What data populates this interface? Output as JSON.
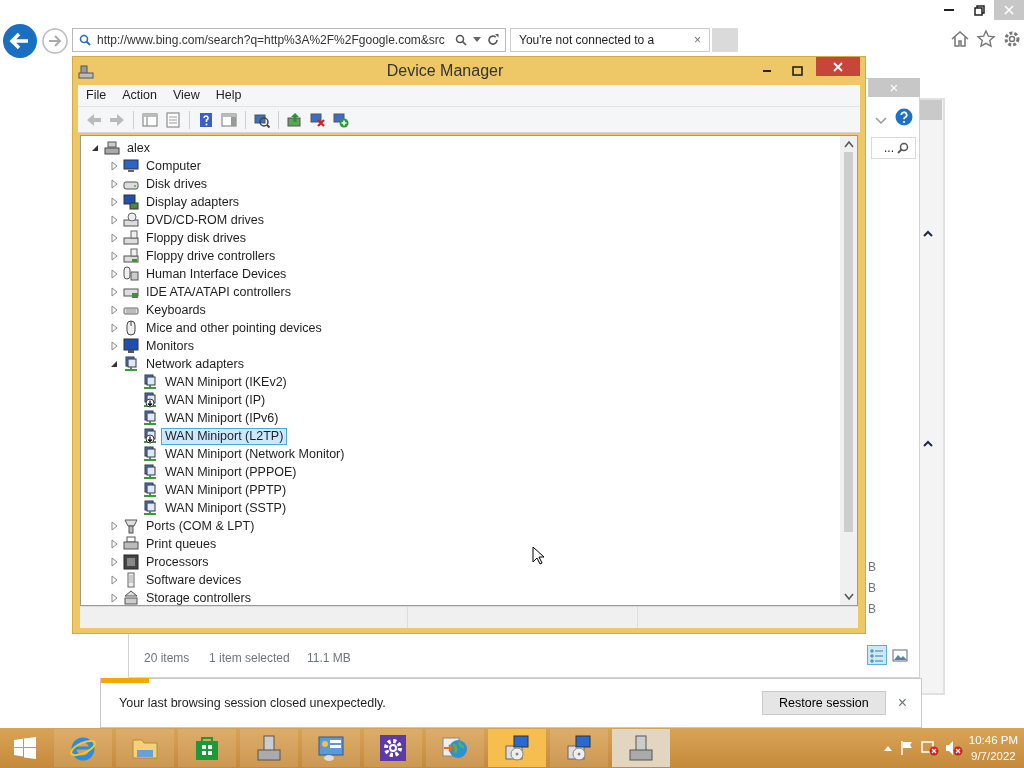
{
  "browser": {
    "address": "http://www.bing.com/search?q=http%3A%2F%2Fgoogle.com&src",
    "tab": {
      "title": "You're not connected to a",
      "close": "×"
    }
  },
  "explorer_dialog": {
    "close": "×",
    "search_text": "...",
    "size_fragments": [
      "B",
      "B",
      "B"
    ],
    "status": {
      "items": "20 items",
      "selection": "1 item selected",
      "size": "11.1 MB"
    },
    "views": [
      {
        "kind": "details",
        "selected": true
      },
      {
        "kind": "preview",
        "selected": false
      }
    ]
  },
  "device_manager": {
    "title": "Device Manager",
    "menu": [
      "File",
      "Action",
      "View",
      "Help"
    ],
    "toolbar": [
      {
        "kind": "back",
        "disabled": true
      },
      {
        "kind": "forward",
        "disabled": true
      },
      {
        "kind": "tree",
        "disabled": false
      },
      {
        "kind": "list",
        "disabled": false
      },
      {
        "kind": "help",
        "disabled": false
      },
      {
        "kind": "panel",
        "disabled": false
      },
      {
        "kind": "scan",
        "disabled": false
      },
      {
        "kind": "update",
        "disabled": false
      },
      {
        "kind": "remove",
        "disabled": false
      },
      {
        "kind": "add",
        "disabled": false
      }
    ],
    "tree": [
      {
        "label": "alex",
        "kind": "root",
        "expanded": true,
        "selected": false,
        "children": [
          {
            "label": "Computer",
            "kind": "computer",
            "expanded": false,
            "selected": false
          },
          {
            "label": "Disk drives",
            "kind": "disk",
            "expanded": false,
            "selected": false
          },
          {
            "label": "Display adapters",
            "kind": "display",
            "expanded": false,
            "selected": false
          },
          {
            "label": "DVD/CD-ROM drives",
            "kind": "dvd",
            "expanded": false,
            "selected": false
          },
          {
            "label": "Floppy disk drives",
            "kind": "floppy",
            "expanded": false,
            "selected": false
          },
          {
            "label": "Floppy drive controllers",
            "kind": "floppyctl",
            "expanded": false,
            "selected": false
          },
          {
            "label": "Human Interface Devices",
            "kind": "hid",
            "expanded": false,
            "selected": false
          },
          {
            "label": "IDE ATA/ATAPI controllers",
            "kind": "ide",
            "expanded": false,
            "selected": false
          },
          {
            "label": "Keyboards",
            "kind": "keyboard",
            "expanded": false,
            "selected": false
          },
          {
            "label": "Mice and other pointing devices",
            "kind": "mouse",
            "expanded": false,
            "selected": false
          },
          {
            "label": "Monitors",
            "kind": "monitor",
            "expanded": false,
            "selected": false
          },
          {
            "label": "Network adapters",
            "kind": "network",
            "expanded": true,
            "selected": false,
            "children": [
              {
                "label": "WAN Miniport (IKEv2)",
                "kind": "network",
                "disabled": false,
                "selected": false
              },
              {
                "label": "WAN Miniport (IP)",
                "kind": "network",
                "disabled": true,
                "selected": false
              },
              {
                "label": "WAN Miniport (IPv6)",
                "kind": "network",
                "disabled": false,
                "selected": false
              },
              {
                "label": "WAN Miniport (L2TP)",
                "kind": "network",
                "disabled": true,
                "selected": true
              },
              {
                "label": "WAN Miniport (Network Monitor)",
                "kind": "network",
                "disabled": false,
                "selected": false
              },
              {
                "label": "WAN Miniport (PPPOE)",
                "kind": "network",
                "disabled": false,
                "selected": false
              },
              {
                "label": "WAN Miniport (PPTP)",
                "kind": "network",
                "disabled": false,
                "selected": false
              },
              {
                "label": "WAN Miniport (SSTP)",
                "kind": "network",
                "disabled": false,
                "selected": false
              }
            ]
          },
          {
            "label": "Ports (COM & LPT)",
            "kind": "port",
            "expanded": false,
            "selected": false
          },
          {
            "label": "Print queues",
            "kind": "printer",
            "expanded": false,
            "selected": false
          },
          {
            "label": "Processors",
            "kind": "processor",
            "expanded": false,
            "selected": false
          },
          {
            "label": "Software devices",
            "kind": "software",
            "expanded": false,
            "selected": false
          },
          {
            "label": "Storage controllers",
            "kind": "storage",
            "expanded": false,
            "selected": false
          }
        ]
      }
    ]
  },
  "notification": {
    "message": "Your last browsing session closed unexpectedly.",
    "button": "Restore session",
    "close": "×"
  },
  "taskbar": {
    "apps": [
      {
        "kind": "ie",
        "selected": false,
        "hovered": false
      },
      {
        "kind": "folder",
        "selected": false,
        "hovered": false
      },
      {
        "kind": "store",
        "selected": false,
        "hovered": false
      },
      {
        "kind": "tower",
        "selected": false,
        "hovered": false
      },
      {
        "kind": "panel",
        "selected": false,
        "hovered": false
      },
      {
        "kind": "gear",
        "selected": false,
        "hovered": false
      },
      {
        "kind": "globe",
        "selected": false,
        "hovered": false
      },
      {
        "kind": "setup",
        "selected": false,
        "hovered": true
      },
      {
        "kind": "setup",
        "selected": false,
        "hovered": false
      },
      {
        "kind": "tower",
        "selected": true,
        "hovered": false
      }
    ],
    "clock": {
      "time": "10:46 PM",
      "date": "9/7/2022"
    }
  }
}
